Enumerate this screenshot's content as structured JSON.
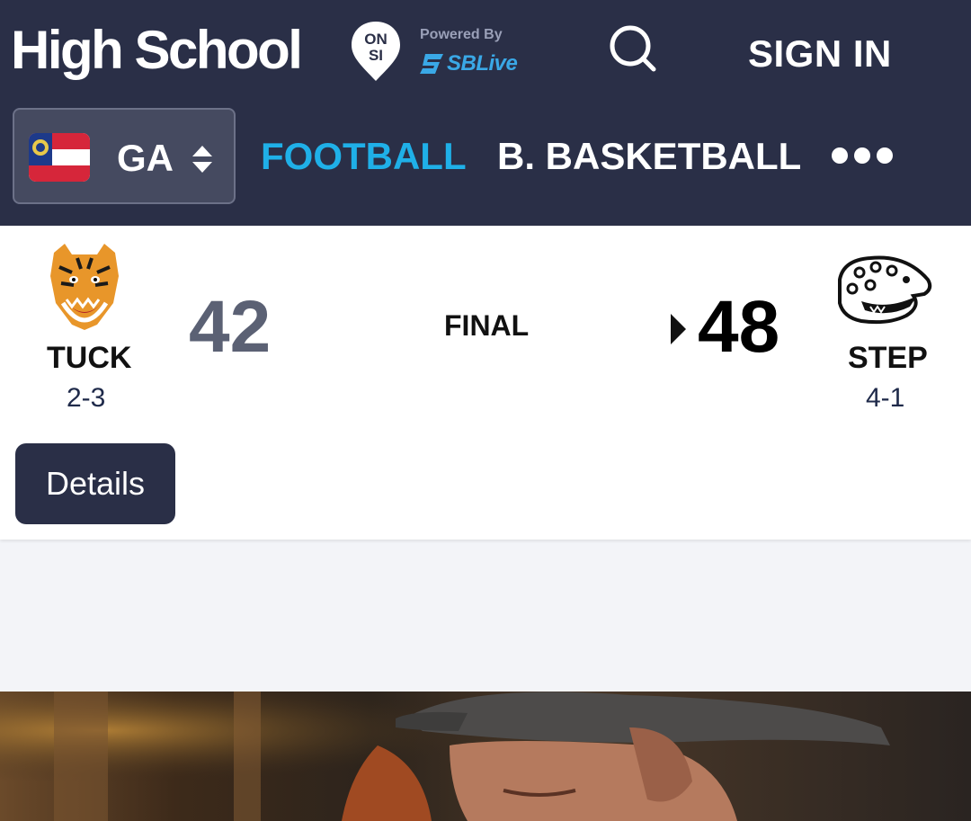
{
  "header": {
    "brand_name": "High School",
    "brand_badge": "ON SI",
    "powered_by": "Powered By",
    "partner_name": "SBLive",
    "sign_in_label": "SIGN IN",
    "search_icon": "search-icon",
    "state": {
      "code": "GA",
      "flag_icon": "georgia-flag-icon",
      "toggle_icon": "up-down-chevrons-icon"
    },
    "tabs": [
      {
        "label": "FOOTBALL",
        "active": true
      },
      {
        "label": "B. BASKETBALL",
        "active": false
      }
    ],
    "more_icon": "more-dots-icon"
  },
  "game": {
    "status": "FINAL",
    "away": {
      "abbr": "TUCK",
      "record": "2-3",
      "score": "42",
      "logo_icon": "tiger-mascot-icon"
    },
    "home": {
      "abbr": "STEP",
      "record": "4-1",
      "score": "48",
      "logo_icon": "jaguar-mascot-icon",
      "winner": true
    },
    "details_label": "Details"
  },
  "colors": {
    "header_bg": "#2a2f47",
    "accent": "#1fb0e8",
    "partner_blue": "#3aa8e6",
    "page_bg": "#f3f4f8",
    "loser_score": "#5b6174"
  },
  "media": {
    "description_icon": "video-thumbnail"
  }
}
